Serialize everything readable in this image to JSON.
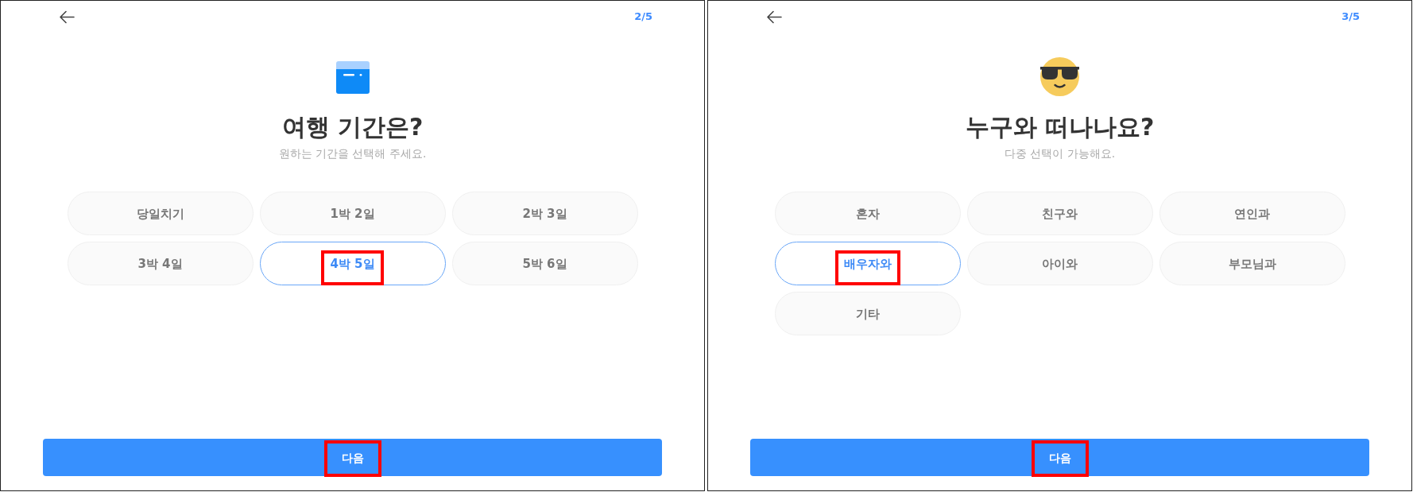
{
  "screens": [
    {
      "kind": "duration",
      "step": "2/5",
      "title": "여행 기간은?",
      "subtitle": "원하는 기간을 선택해 주세요.",
      "options": [
        {
          "label": "당일치기",
          "selected": false,
          "highlighted": false
        },
        {
          "label": "1박 2일",
          "selected": false,
          "highlighted": false
        },
        {
          "label": "2박 3일",
          "selected": false,
          "highlighted": false
        },
        {
          "label": "3박 4일",
          "selected": false,
          "highlighted": false
        },
        {
          "label": "4박 5일",
          "selected": true,
          "highlighted": true
        },
        {
          "label": "5박 6일",
          "selected": false,
          "highlighted": false
        }
      ],
      "next_button": {
        "label": "다음",
        "highlighted": true
      }
    },
    {
      "kind": "companions",
      "step": "3/5",
      "title": "누구와 떠나나요?",
      "subtitle": "다중 선택이 가능해요.",
      "options": [
        {
          "label": "혼자",
          "selected": false,
          "highlighted": false
        },
        {
          "label": "친구와",
          "selected": false,
          "highlighted": false
        },
        {
          "label": "연인과",
          "selected": false,
          "highlighted": false
        },
        {
          "label": "배우자와",
          "selected": true,
          "highlighted": true
        },
        {
          "label": "아이와",
          "selected": false,
          "highlighted": false
        },
        {
          "label": "부모님과",
          "selected": false,
          "highlighted": false
        },
        {
          "label": "기타",
          "selected": false,
          "highlighted": false
        }
      ],
      "next_button": {
        "label": "다음",
        "highlighted": true
      }
    }
  ]
}
